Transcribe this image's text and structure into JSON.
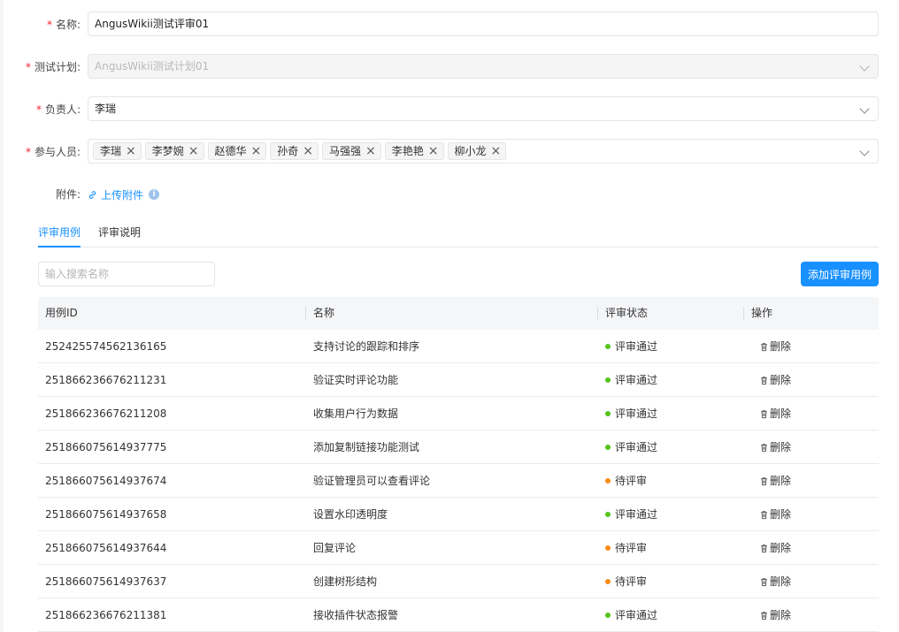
{
  "form": {
    "name_label": "名称:",
    "name_value": "AngusWikii测试评审01",
    "plan_label": "测试计划:",
    "plan_value": "AngusWikii测试计划01",
    "owner_label": "负责人:",
    "owner_value": "李瑞",
    "participants_label": "参与人员:",
    "participants": [
      "李瑞",
      "李梦婉",
      "赵德华",
      "孙奇",
      "马强强",
      "李艳艳",
      "柳小龙"
    ],
    "attachment_label": "附件:",
    "upload_label": "上传附件",
    "required_mark": "*"
  },
  "tabs": [
    {
      "label": "评审用例",
      "active": true
    },
    {
      "label": "评审说明",
      "active": false
    }
  ],
  "search": {
    "placeholder": "输入搜索名称",
    "value": ""
  },
  "add_button": "添加评审用例",
  "table": {
    "columns": [
      "用例ID",
      "名称",
      "评审状态",
      "操作"
    ],
    "rows": [
      {
        "id": "252425574562136165",
        "name": "支持讨论的跟踪和排序",
        "status": "评审通过",
        "action": "删除"
      },
      {
        "id": "251866236676211231",
        "name": "验证实时评论功能",
        "status": "评审通过",
        "action": "删除"
      },
      {
        "id": "251866236676211208",
        "name": "收集用户行为数据",
        "status": "评审通过",
        "action": "删除"
      },
      {
        "id": "251866075614937775",
        "name": "添加复制链接功能测试",
        "status": "评审通过",
        "action": "删除"
      },
      {
        "id": "251866075614937674",
        "name": "验证管理员可以查看评论",
        "status": "待评审",
        "action": "删除"
      },
      {
        "id": "251866075614937658",
        "name": "设置水印透明度",
        "status": "评审通过",
        "action": "删除"
      },
      {
        "id": "251866075614937644",
        "name": "回复评论",
        "status": "待评审",
        "action": "删除"
      },
      {
        "id": "251866075614937637",
        "name": "创建树形结构",
        "status": "待评审",
        "action": "删除"
      },
      {
        "id": "251866236676211381",
        "name": "接收插件状态报警",
        "status": "评审通过",
        "action": "删除"
      }
    ]
  },
  "colors": {
    "accent": "#1890ff",
    "passed": "#52c41a",
    "pending": "#fa8c16",
    "required": "#f5222d"
  }
}
